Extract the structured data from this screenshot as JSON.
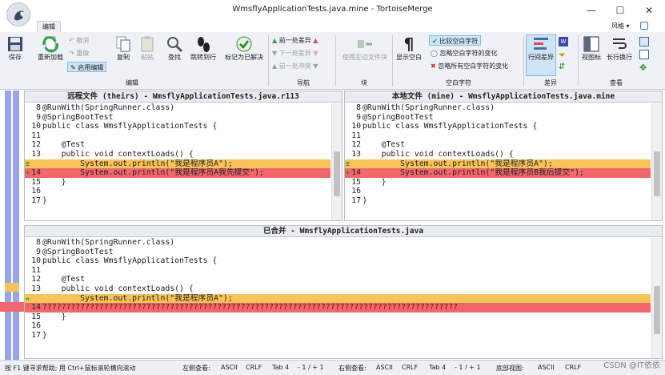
{
  "window": {
    "title": "WmsflyApplicationTests.java.mine - TortoiseMerge",
    "min": "—",
    "max": "☐",
    "close": "✕"
  },
  "tabs": {
    "edit": "编辑"
  },
  "style_menu": "风格 ▾",
  "ribbon": {
    "save": "保存",
    "reload": "重新加载",
    "undo": "撤消",
    "redo": "重做",
    "enable_edit": "启用编辑",
    "copy": "复制",
    "paste": "粘贴",
    "find": "查找",
    "goto_line": "跳转到行",
    "mark_resolved": "标记为已解决",
    "prev_diff": "前一处差异",
    "next_diff": "下一处差异",
    "prev_conflict": "前一处冲突",
    "use_left_block": "使用左边文件块",
    "show_whitespace": "显示空白",
    "compare_ws": "比较空白字符",
    "ignore_ws_change": "忽略空白字符的变化",
    "ignore_all_ws": "忽略所有空白字符的变化",
    "inline_diff": "行间差异",
    "view_icon": "视图标",
    "wrap_lines": "长行换行",
    "groups": {
      "edit": "编辑",
      "nav": "导航",
      "block": "块",
      "whitespace": "空白字符",
      "diff": "差异",
      "view": "查看"
    }
  },
  "theirs": {
    "header": "远程文件 (theirs) - WmsflyApplicationTests.java.r113",
    "lines": [
      {
        "n": "8",
        "t": "@RunWith(SpringRunner.class)"
      },
      {
        "n": "9",
        "t": "@SpringBootTest"
      },
      {
        "n": "10",
        "t": "public class WmsflyApplicationTests {"
      },
      {
        "n": "11",
        "t": ""
      },
      {
        "n": "12",
        "t": "    @Test"
      },
      {
        "n": "13",
        "t": "    public void contextLoads() {"
      },
      {
        "n": "",
        "t": "        System.out.println(\"我是程序员A\");",
        "c": "y",
        "m": "≡"
      },
      {
        "n": "14",
        "t": "        System.out.println(\"我是程序员A我先提交\");",
        "c": "r",
        "m": "+"
      },
      {
        "n": "15",
        "t": "    }"
      },
      {
        "n": "16",
        "t": ""
      },
      {
        "n": "17",
        "t": "}"
      }
    ]
  },
  "mine": {
    "header": "本地文件 (mine) - WmsflyApplicationTests.java.mine",
    "lines": [
      {
        "n": "8",
        "t": "@RunWith(SpringRunner.class)"
      },
      {
        "n": "9",
        "t": "@SpringBootTest"
      },
      {
        "n": "10",
        "t": "public class WmsflyApplicationTests {"
      },
      {
        "n": "11",
        "t": ""
      },
      {
        "n": "12",
        "t": "    @Test"
      },
      {
        "n": "13",
        "t": "    public void contextLoads() {"
      },
      {
        "n": "",
        "t": "        System.out.println(\"我是程序员A\");",
        "c": "y",
        "m": "≡"
      },
      {
        "n": "14",
        "t": "        System.out.println(\"我是程序员B我后提交\");",
        "c": "r",
        "m": "+"
      },
      {
        "n": "15",
        "t": "    }"
      },
      {
        "n": "16",
        "t": ""
      },
      {
        "n": "17",
        "t": "}"
      }
    ]
  },
  "merged": {
    "header": "已合并 - WmsflyApplicationTests.java",
    "lines": [
      {
        "n": "8",
        "t": "@RunWith(SpringRunner.class)"
      },
      {
        "n": "9",
        "t": "@SpringBootTest"
      },
      {
        "n": "10",
        "t": "public class WmsflyApplicationTests {"
      },
      {
        "n": "11",
        "t": ""
      },
      {
        "n": "12",
        "t": "    @Test"
      },
      {
        "n": "13",
        "t": "    public void contextLoads() {"
      },
      {
        "n": "",
        "t": "        System.out.println(\"我是程序员A\");",
        "c": "y",
        "m": "↔"
      },
      {
        "n": "14",
        "t": "????????????????????????????????????????????????????????????????????????????????????????",
        "c": "rr",
        "m": "!"
      },
      {
        "n": "15",
        "t": "    }"
      },
      {
        "n": "16",
        "t": ""
      },
      {
        "n": "17",
        "t": "}"
      }
    ]
  },
  "status": {
    "help": "按 F1 键寻求帮助; 用 Ctrl+鼠标滚轮横向滚动",
    "left_view": "左侧查看:",
    "right_view": "右侧查看:",
    "bottom_view": "底部视图:",
    "enc": "ASCII",
    "eol": "CRLF",
    "tab": "Tab 4",
    "pos": "- 1 / + 1"
  },
  "watermark": "CSDN @IT依依"
}
